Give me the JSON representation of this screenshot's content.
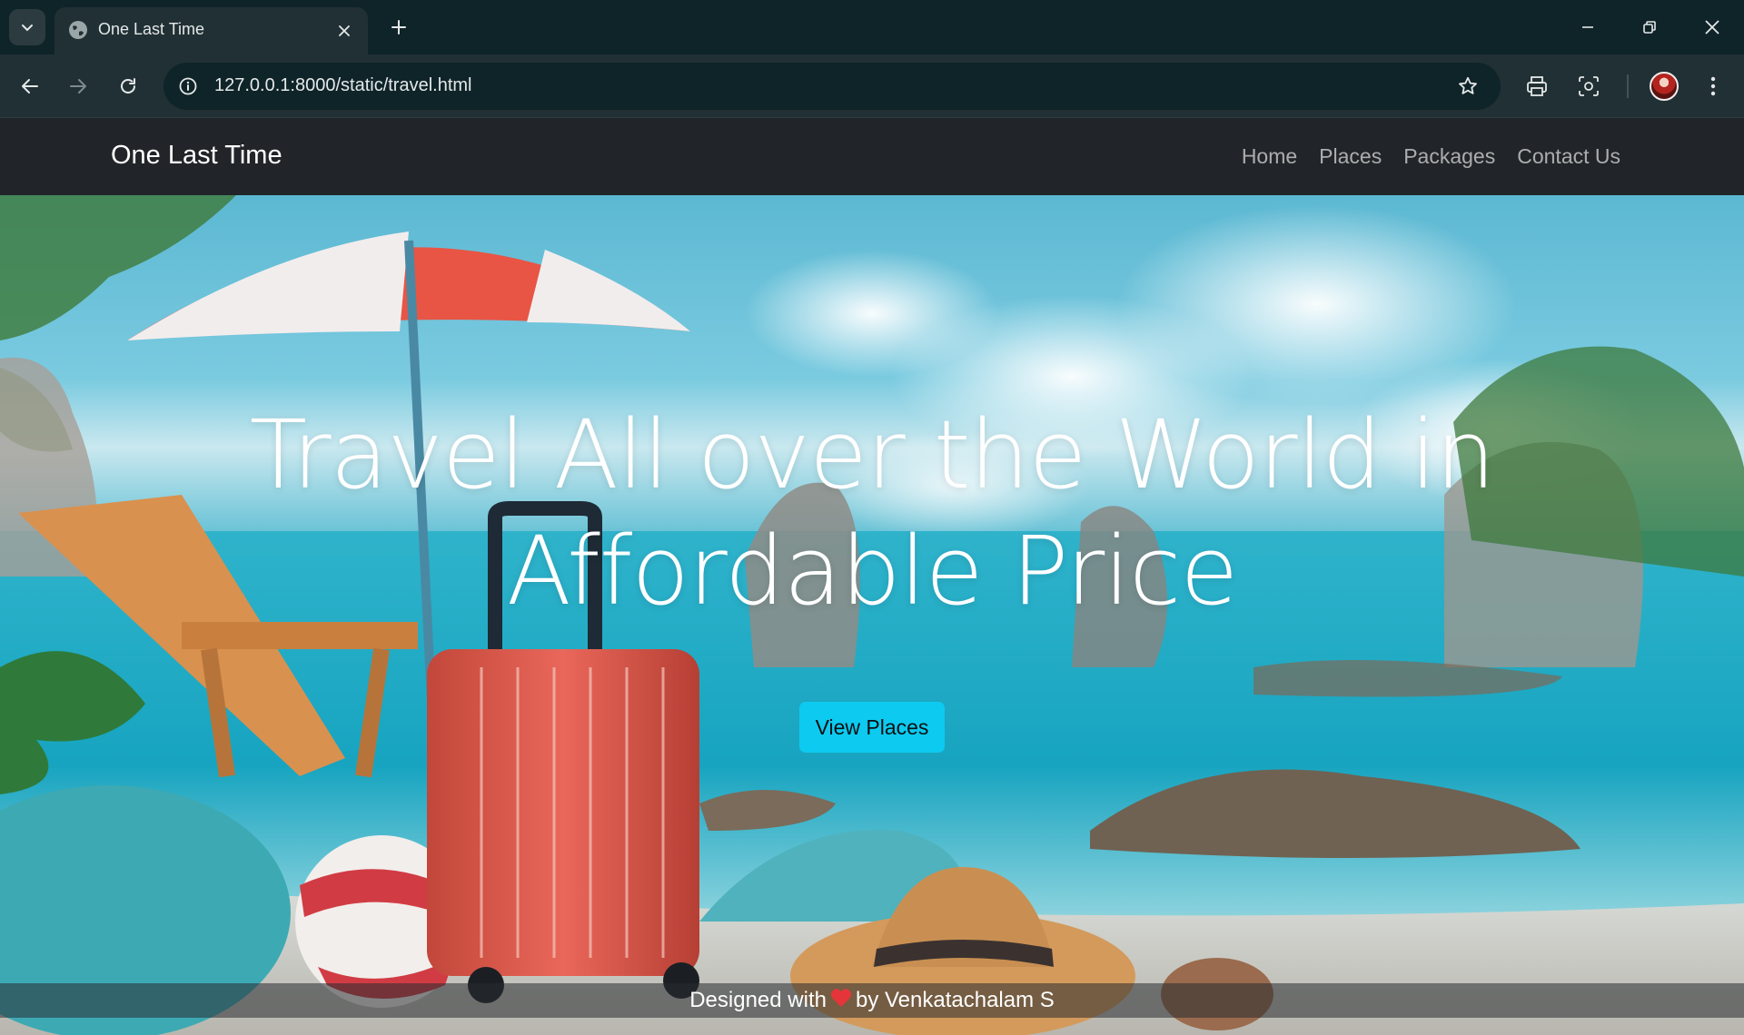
{
  "browser": {
    "tab_title": "One Last Time",
    "url": "127.0.0.1:8000/static/travel.html"
  },
  "site": {
    "brand": "One Last Time",
    "nav": [
      "Home",
      "Places",
      "Packages",
      "Contact Us"
    ]
  },
  "hero": {
    "title_line1": "Travel All over the World in",
    "title_line2": "Affordable Price",
    "cta_label": "View Places"
  },
  "footer": {
    "text_before": "Designed with",
    "heart_icon": "heart-icon",
    "text_after": "by Venkatachalam S"
  },
  "colors": {
    "cta": "#0dcaf0",
    "navbar": "#212529",
    "heart": "#e5353a"
  }
}
